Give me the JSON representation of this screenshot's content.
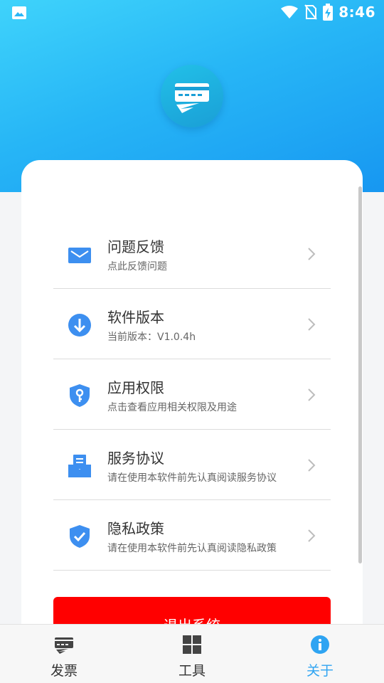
{
  "status_bar": {
    "time": "8:46",
    "icons": [
      "image-icon",
      "wifi-icon",
      "no-sim-icon",
      "battery-charging-icon"
    ]
  },
  "app": {
    "logo_icon": "invoice-logo-icon",
    "brand_color": "#1a9fd6",
    "hero_gradient": [
      "#3fd3fb",
      "#1797f1"
    ]
  },
  "menu": {
    "items": [
      {
        "icon": "mail-icon",
        "title": "问题反馈",
        "subtitle": "点此反馈问题"
      },
      {
        "icon": "download-icon",
        "title": "软件版本",
        "subtitle": "当前版本：V1.0.4h"
      },
      {
        "icon": "shield-key-icon",
        "title": "应用权限",
        "subtitle": "点击查看应用相关权限及用途"
      },
      {
        "icon": "agreement-icon",
        "title": "服务协议",
        "subtitle": "请在使用本软件前先认真阅读服务协议"
      },
      {
        "icon": "shield-check-icon",
        "title": "隐私政策",
        "subtitle": "请在使用本软件前先认真阅读隐私政策"
      }
    ]
  },
  "logout": {
    "label": "退出系统",
    "color": "#ff0000"
  },
  "tabbar": {
    "active_color": "#2fa4f2",
    "tabs": [
      {
        "icon": "invoice-icon",
        "label": "发票",
        "active": false
      },
      {
        "icon": "grid-icon",
        "label": "工具",
        "active": false
      },
      {
        "icon": "info-icon",
        "label": "关于",
        "active": true
      }
    ]
  }
}
